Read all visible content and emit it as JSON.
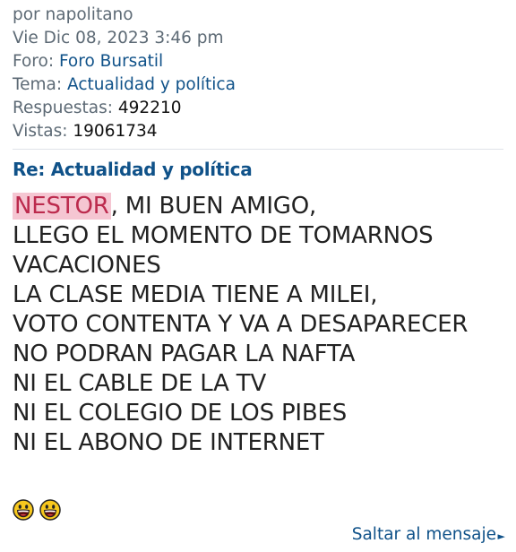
{
  "meta": {
    "author_line": "por napolitano",
    "date": "Vie Dic 08, 2023 3:46 pm",
    "forum_label": "Foro:",
    "forum_name": "Foro Bursatil",
    "topic_label": "Tema:",
    "topic_name": "Actualidad y política",
    "replies_label": "Respuestas:",
    "replies_count": "492210",
    "views_label": "Vistas:",
    "views_count": "19061734"
  },
  "post": {
    "title": "Re: Actualidad y política",
    "highlighted_word": "NESTOR",
    "first_line_rest": ", MI BUEN AMIGO,",
    "lines": [
      "LLEGO EL MOMENTO DE TOMARNOS",
      "VACACIONES",
      "LA CLASE MEDIA TIENE A MILEI,",
      "VOTO CONTENTA Y VA A DESAPARECER",
      "NO PODRAN PAGAR LA NAFTA",
      "NI EL CABLE DE LA TV",
      "NI EL COLEGIO DE LOS PIBES",
      "NI EL ABONO DE INTERNET"
    ],
    "smilies": [
      "laughing-smiley-icon",
      "laughing-smiley-icon"
    ]
  },
  "footer": {
    "jump_label": "Saltar al mensaje"
  },
  "colors": {
    "link": "#105289",
    "meta": "#5d6a75",
    "highlight_bg": "#f5c6d2",
    "highlight_text": "#bc2a4d"
  }
}
